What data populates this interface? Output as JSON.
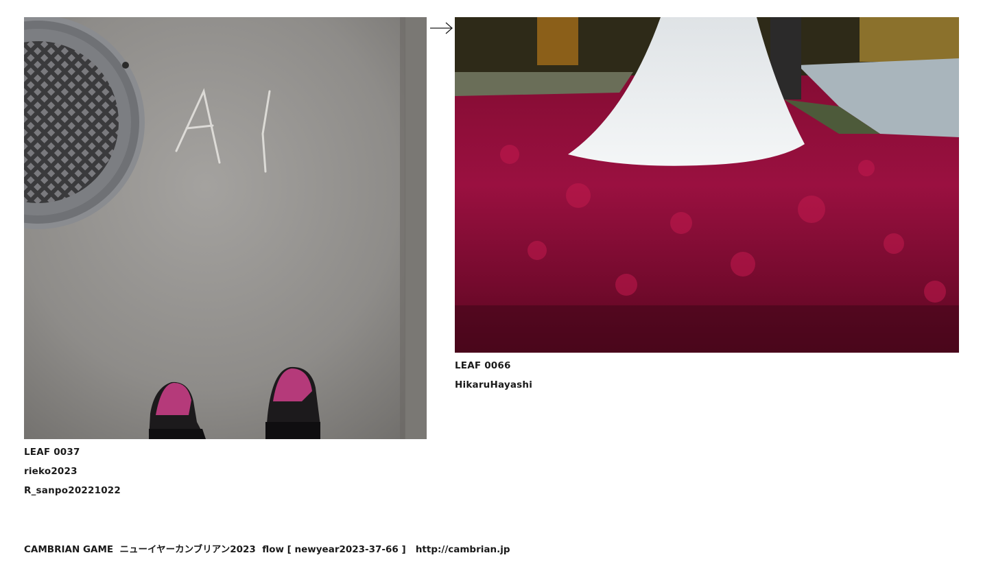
{
  "leaves": [
    {
      "id": "LEAF 0037",
      "author": "rieko2023",
      "title": "R_sanpo20221022",
      "image_alt": "asphalt road with manhole cover, chalk letters and feet in pink socks"
    },
    {
      "id": "LEAF 0066",
      "author": "HikaruHayashi",
      "image_alt": "white wedding dress on a carpet of red autumn leaves by a lake"
    }
  ],
  "chalk_text": "AI",
  "arrow_icon": "right-arrow-icon",
  "footer": {
    "game": "CAMBRIAN GAME",
    "event": "ニューイヤーカンブリアン2023",
    "flow": "flow [ newyear2023-37-66 ]",
    "url": "http://cambrian.jp"
  },
  "colors": {
    "asphalt": "#8f8d8a",
    "leaves": "#8e0b35",
    "dress": "#eef0f0",
    "text": "#1a1a1a"
  }
}
